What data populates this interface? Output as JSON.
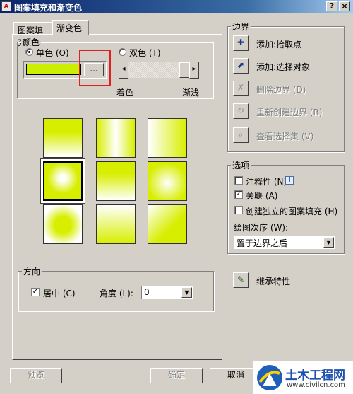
{
  "window": {
    "title": "图案填充和渐变色",
    "help_label": "?",
    "close_label": "×"
  },
  "tabs": [
    {
      "label": "图案填充"
    },
    {
      "label": "渐变色"
    }
  ],
  "color_group": {
    "legend": "颜色",
    "one_color": "单色 (O)",
    "two_color": "双色 (T)",
    "selected": "one_color",
    "swatch_color": "#ccee00",
    "browse_label": "...",
    "shade_label": "着色",
    "tint_label": "渐浅",
    "slider_left": "◂",
    "slider_right": "▸"
  },
  "gradient_patterns": {
    "count": 9,
    "selected_index": 3,
    "color": "#d8ee00"
  },
  "orientation_group": {
    "legend": "方向",
    "centered_label": "居中 (C)",
    "centered_checked": true,
    "angle_label": "角度 (L):",
    "angle_value": "0"
  },
  "boundaries_group": {
    "legend": "边界",
    "add_pick_points": "添加:拾取点",
    "add_select_objects": "添加:选择对象",
    "remove_boundaries": "删除边界 (D)",
    "recreate_boundary": "重新创建边界 (R)",
    "view_selections": "查看选择集 (V)"
  },
  "options_group": {
    "legend": "选项",
    "annotative": "注释性 (N)",
    "annotative_info": "i",
    "associative": "关联 (A)",
    "associative_checked": true,
    "separate_hatches": "创建独立的图案填充 (H)",
    "draw_order_label": "绘图次序 (W):",
    "draw_order_value": "置于边界之后"
  },
  "inherit_properties": "继承特性",
  "footer": {
    "preview": "预览",
    "ok": "确定",
    "cancel": "取消"
  },
  "watermark": {
    "text": "土木工程网",
    "url": "www.civilcn.com"
  }
}
